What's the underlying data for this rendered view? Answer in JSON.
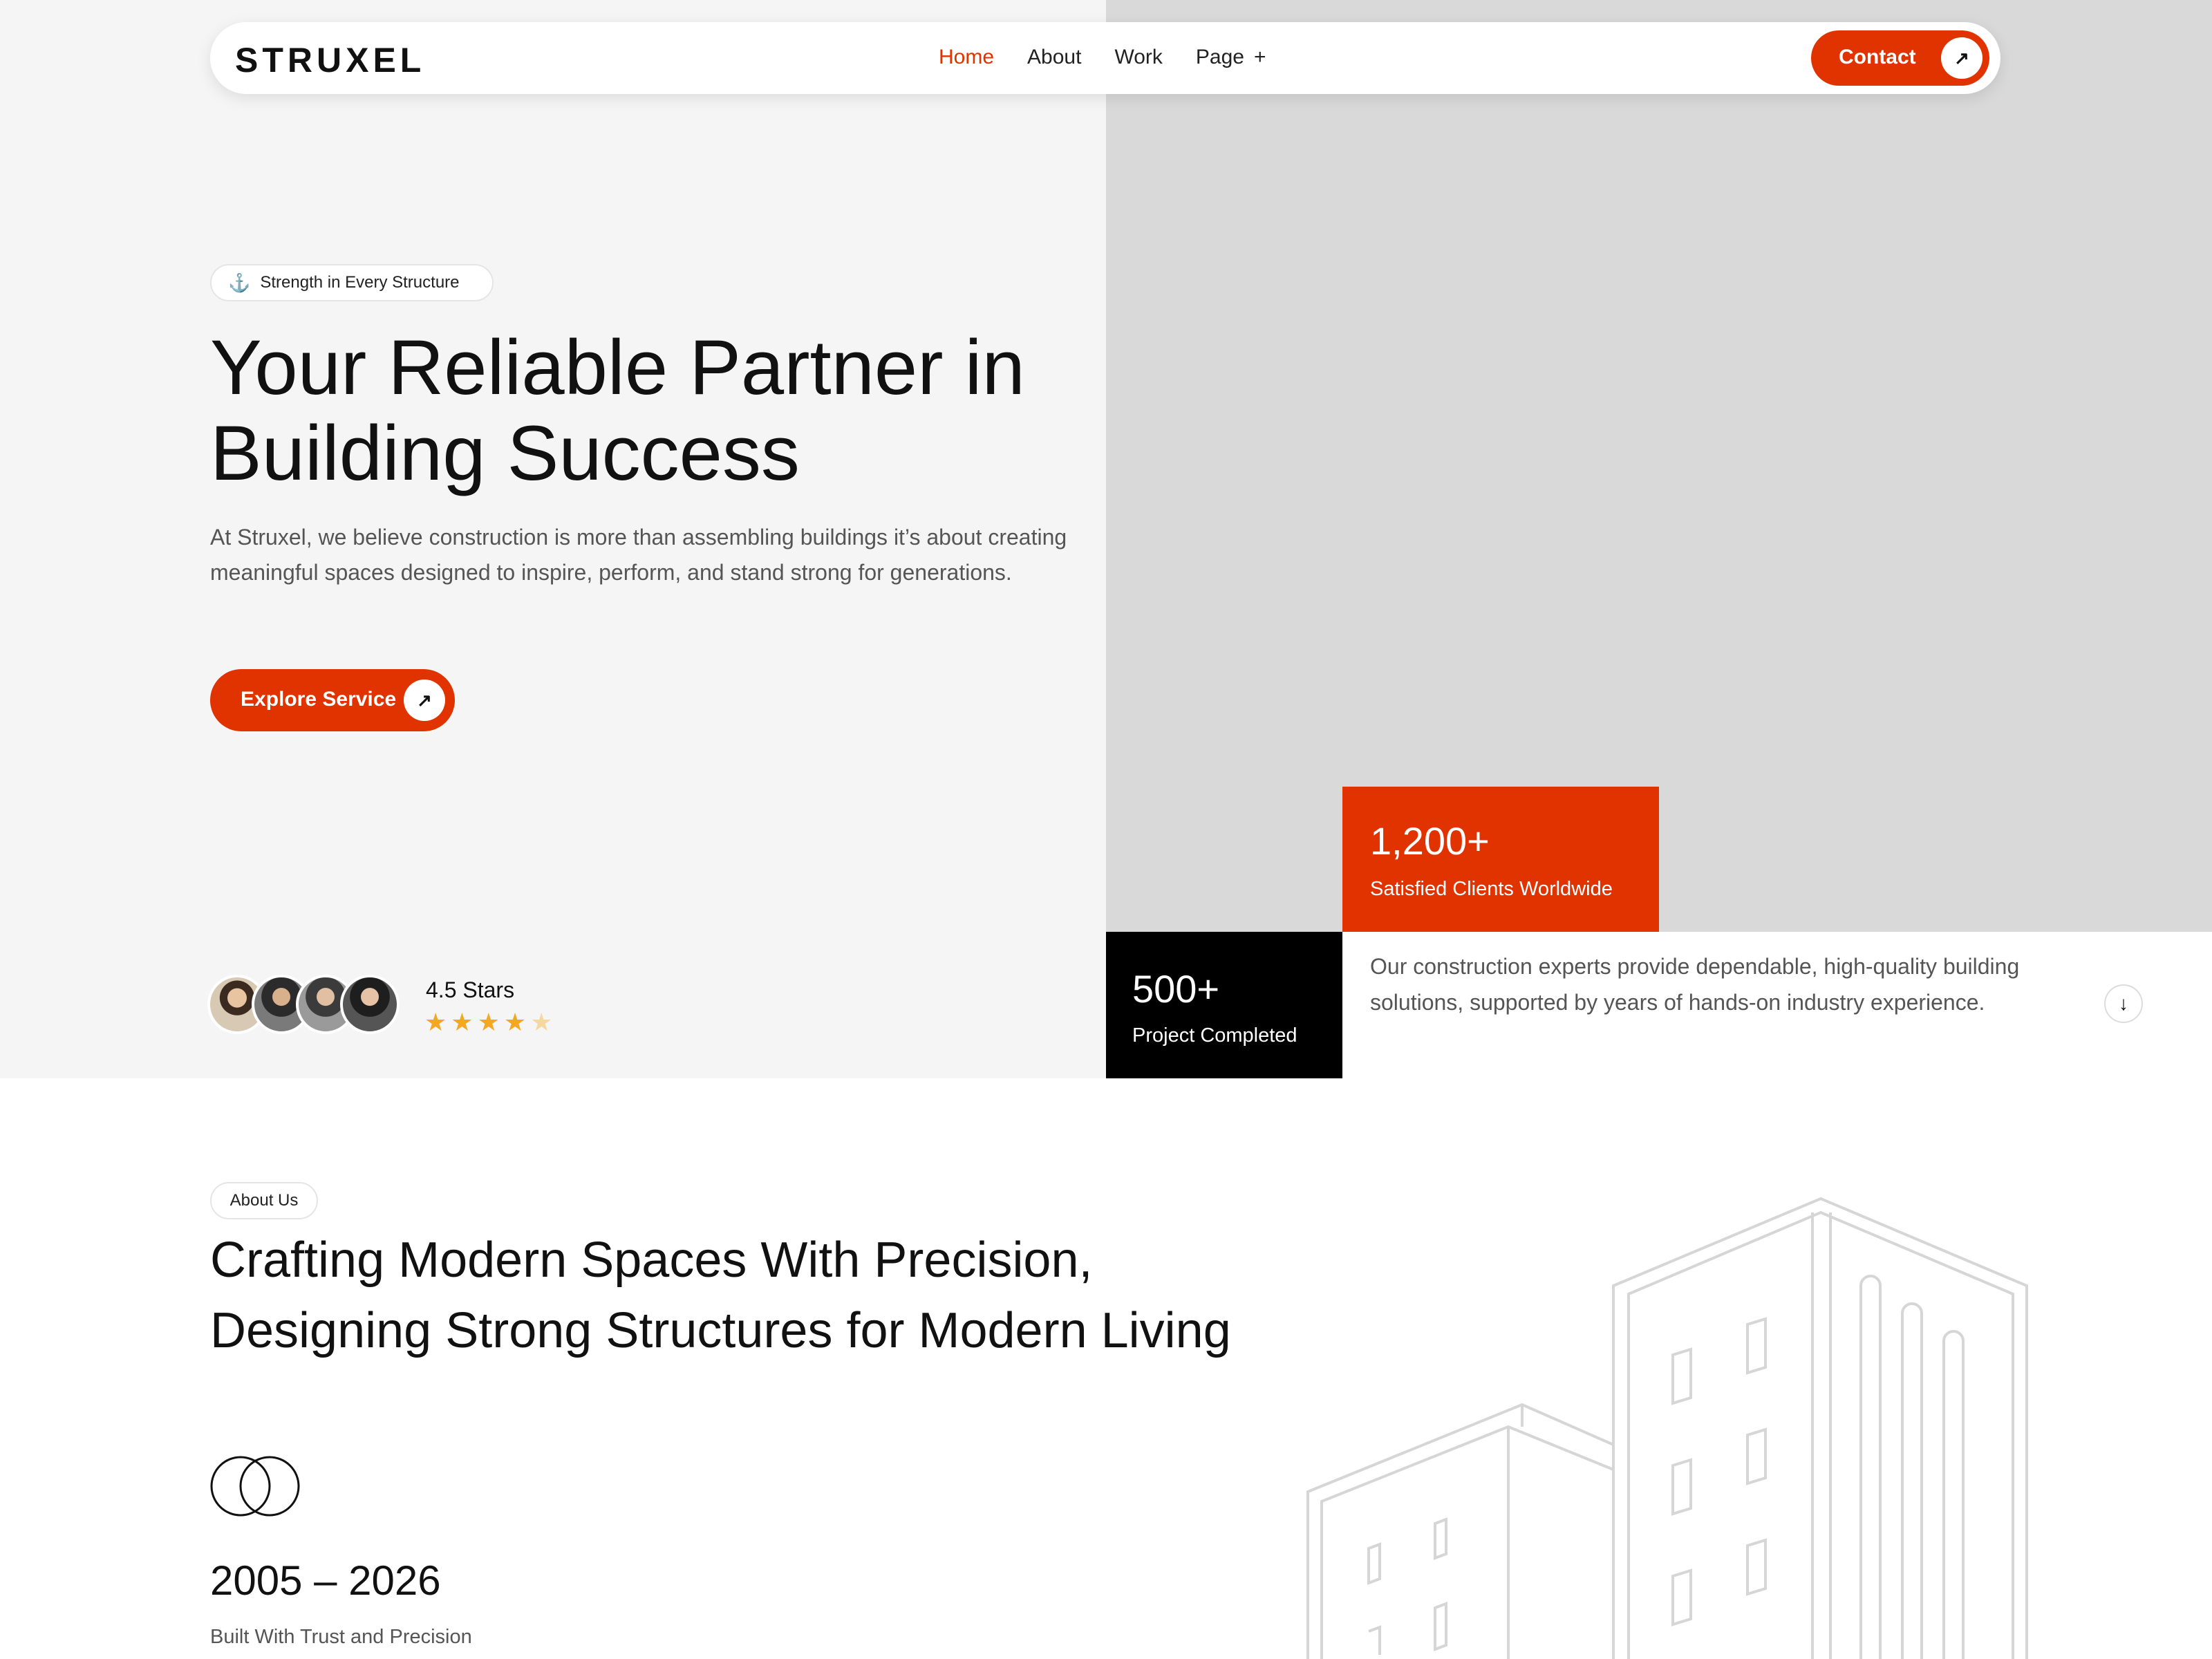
{
  "header": {
    "logo": "STRUXEL",
    "nav": [
      {
        "label": "Home",
        "active": true
      },
      {
        "label": "About",
        "active": false
      },
      {
        "label": "Work",
        "active": false
      },
      {
        "label": "Page",
        "active": false
      }
    ],
    "page_expand_icon": "plus",
    "contact_label": "Contact",
    "contact_icon": "arrow-up-right"
  },
  "hero": {
    "tag": "Strength in Every Structure",
    "tag_icon": "anchor",
    "title_line1": "Your Reliable Partner in",
    "title_line2": "Building Success",
    "description": "At Struxel, we believe construction is more than assembling buildings it’s about creating meaningful spaces designed to inspire, perform, and stand strong for generations.",
    "cta_label": "Explore Service",
    "cta_icon": "arrow-up-right",
    "rating_label": "4.5 Stars",
    "rating_value": 4.5,
    "rating_max": 5,
    "star_glyph": "★"
  },
  "stats": {
    "clients_value": "1,200+",
    "clients_label": "Satisfied Clients Worldwide",
    "projects_value": "500+",
    "projects_label": "Project Completed"
  },
  "experts_text": "Our construction experts provide dependable, high-quality building solutions, supported by years of hands-on industry experience.",
  "scroll_icon": "arrow-down",
  "about": {
    "tag": "About Us",
    "title_line1": "Crafting Modern Spaces With Precision,",
    "title_line2": "Designing Strong Structures for Modern Living",
    "years": "2005 – 2026",
    "years_sub": "Built With Trust and Precision"
  },
  "colors": {
    "accent": "#e03300",
    "dark": "#111111",
    "hero_left_bg": "#f5f5f5",
    "hero_right_bg": "#d9d9d9",
    "star": "#f5a623"
  }
}
